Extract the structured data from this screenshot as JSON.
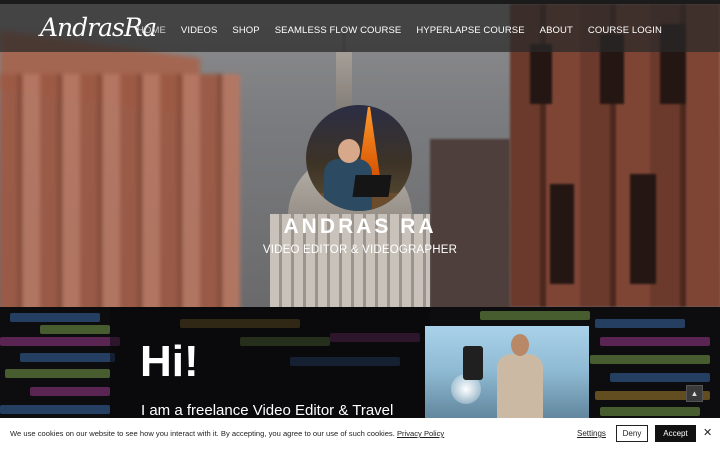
{
  "nav": {
    "logo_text": "AndrasRa",
    "items": [
      {
        "label": "HOME",
        "active": true
      },
      {
        "label": "VIDEOS",
        "active": false
      },
      {
        "label": "SHOP",
        "active": false
      },
      {
        "label": "SEAMLESS FLOW COURSE",
        "active": false
      },
      {
        "label": "HYPERLAPSE COURSE",
        "active": false
      },
      {
        "label": "ABOUT",
        "active": false
      },
      {
        "label": "COURSE LOGIN",
        "active": false
      }
    ]
  },
  "hero": {
    "name": "ANDRAS RA",
    "subtitle": "VIDEO EDITOR & VIDEOGRAPHER"
  },
  "intro": {
    "greeting": "Hi!",
    "text": "I am a freelance Video Editor & Travel"
  },
  "scroll_top": {
    "icon": "chevron-up-icon",
    "glyph": "▲"
  },
  "cookie": {
    "text": "We use cookies on our website to see how you interact with it. By accepting, you agree to our use of such cookies.",
    "policy_link": "Privacy Policy",
    "settings_label": "Settings",
    "deny_label": "Deny",
    "accept_label": "Accept",
    "close_glyph": "✕"
  },
  "colors": {
    "nav_bg": "#282828",
    "cookie_bg": "#ffffff",
    "accept_bg": "#111111"
  }
}
